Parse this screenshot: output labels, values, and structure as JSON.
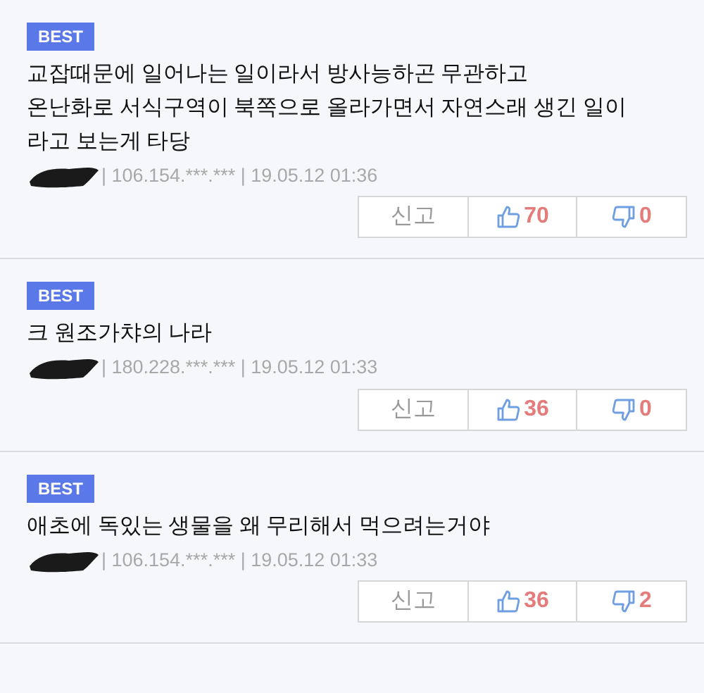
{
  "comments": [
    {
      "badge": "BEST",
      "text": "교잡때문에 일어나는 일이라서 방사능하곤 무관하고\n온난화로 서식구역이 북쪽으로 올라가면서 자연스래 생긴 일이\n라고 보는게 타당",
      "ip": "| 106.154.***.*** | 19.05.12 01:36",
      "report": "신고",
      "likes": "70",
      "dislikes": "0"
    },
    {
      "badge": "BEST",
      "text": "크 원조가챠의 나라",
      "ip": "| 180.228.***.*** | 19.05.12 01:33",
      "report": "신고",
      "likes": "36",
      "dislikes": "0"
    },
    {
      "badge": "BEST",
      "text": "애초에 독있는 생물을 왜 무리해서 먹으려는거야",
      "ip": "| 106.154.***.*** | 19.05.12 01:33",
      "report": "신고",
      "likes": "36",
      "dislikes": "2"
    }
  ]
}
